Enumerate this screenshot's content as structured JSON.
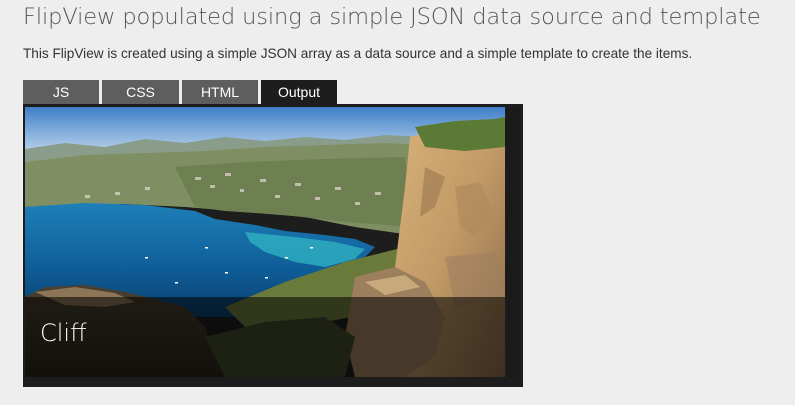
{
  "page": {
    "title": "FlipView populated using a simple JSON data source and template",
    "description": "This FlipView is created using a simple JSON array as a data source and a simple template to create the items."
  },
  "tabs": [
    {
      "label": "JS",
      "active": false
    },
    {
      "label": "CSS",
      "active": false
    },
    {
      "label": "HTML",
      "active": false
    },
    {
      "label": "Output",
      "active": true
    }
  ],
  "flipview": {
    "current_item": {
      "caption": "Cliff",
      "image": "coastal-cliff-bay-photo"
    }
  },
  "colors": {
    "background": "#eeeeee",
    "tab": "#5e5e5e",
    "tab_active": "#1d1d1d",
    "panel": "#1d1d1d",
    "title_text": "#555555"
  }
}
